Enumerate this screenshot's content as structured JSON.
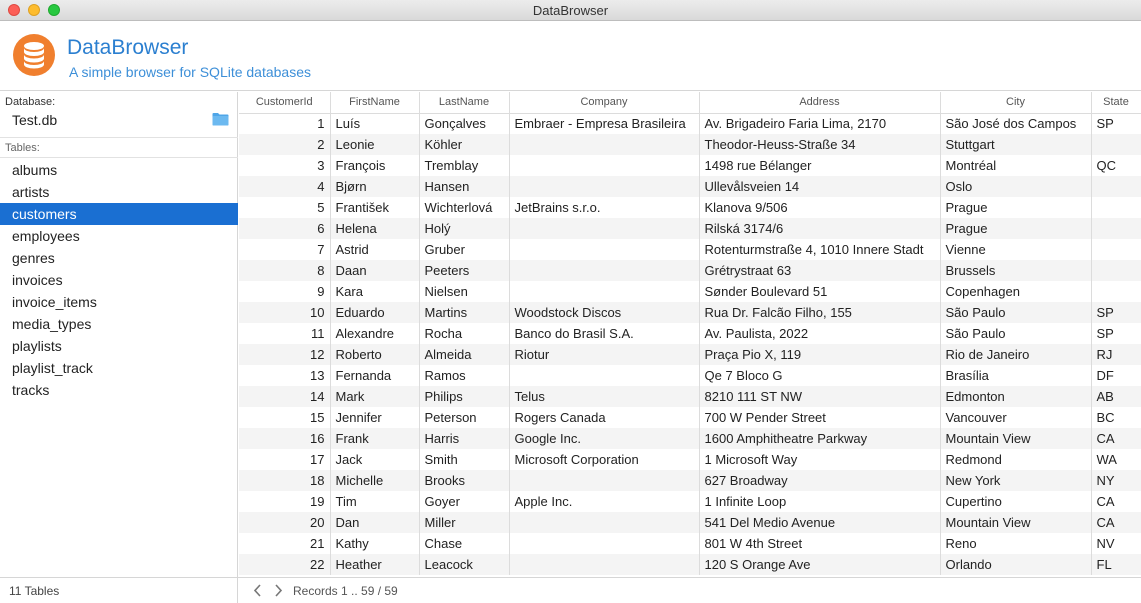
{
  "window": {
    "title": "DataBrowser"
  },
  "header": {
    "app_name": "DataBrowser",
    "tagline": "A simple browser for SQLite databases",
    "logo_icon": "database-icon",
    "accent_color": "#2b7fd0",
    "logo_color": "#f07f2e"
  },
  "sidebar": {
    "database_label": "Database:",
    "database_name": "Test.db",
    "folder_icon": "folder-icon",
    "tables_label": "Tables:",
    "selected": "customers",
    "selection_color": "#1a6fd2",
    "tables": [
      "albums",
      "artists",
      "customers",
      "employees",
      "genres",
      "invoices",
      "invoice_items",
      "media_types",
      "playlists",
      "playlist_track",
      "tracks"
    ]
  },
  "grid": {
    "columns": [
      "CustomerId",
      "FirstName",
      "LastName",
      "Company",
      "Address",
      "City",
      "State"
    ],
    "rows": [
      [
        "1",
        "Luís",
        "Gonçalves",
        "Embraer - Empresa Brasileira",
        "Av. Brigadeiro Faria Lima, 2170",
        "São José dos Campos",
        "SP"
      ],
      [
        "2",
        "Leonie",
        "Köhler",
        "",
        "Theodor-Heuss-Straße 34",
        "Stuttgart",
        ""
      ],
      [
        "3",
        "François",
        "Tremblay",
        "",
        "1498 rue Bélanger",
        "Montréal",
        "QC"
      ],
      [
        "4",
        "Bjørn",
        "Hansen",
        "",
        "Ullevålsveien 14",
        "Oslo",
        ""
      ],
      [
        "5",
        "František",
        "Wichterlová",
        "JetBrains s.r.o.",
        "Klanova 9/506",
        "Prague",
        ""
      ],
      [
        "6",
        "Helena",
        "Holý",
        "",
        "Rilská 3174/6",
        "Prague",
        ""
      ],
      [
        "7",
        "Astrid",
        "Gruber",
        "",
        "Rotenturmstraße 4, 1010 Innere Stadt",
        "Vienne",
        ""
      ],
      [
        "8",
        "Daan",
        "Peeters",
        "",
        "Grétrystraat 63",
        "Brussels",
        ""
      ],
      [
        "9",
        "Kara",
        "Nielsen",
        "",
        "Sønder Boulevard 51",
        "Copenhagen",
        ""
      ],
      [
        "10",
        "Eduardo",
        "Martins",
        "Woodstock Discos",
        "Rua Dr. Falcão Filho, 155",
        "São Paulo",
        "SP"
      ],
      [
        "11",
        "Alexandre",
        "Rocha",
        "Banco do Brasil S.A.",
        "Av. Paulista, 2022",
        "São Paulo",
        "SP"
      ],
      [
        "12",
        "Roberto",
        "Almeida",
        "Riotur",
        "Praça Pio X, 119",
        "Rio de Janeiro",
        "RJ"
      ],
      [
        "13",
        "Fernanda",
        "Ramos",
        "",
        "Qe 7 Bloco G",
        "Brasília",
        "DF"
      ],
      [
        "14",
        "Mark",
        "Philips",
        "Telus",
        "8210 111 ST NW",
        "Edmonton",
        "AB"
      ],
      [
        "15",
        "Jennifer",
        "Peterson",
        "Rogers Canada",
        "700 W Pender Street",
        "Vancouver",
        "BC"
      ],
      [
        "16",
        "Frank",
        "Harris",
        "Google Inc.",
        "1600 Amphitheatre Parkway",
        "Mountain View",
        "CA"
      ],
      [
        "17",
        "Jack",
        "Smith",
        "Microsoft Corporation",
        "1 Microsoft Way",
        "Redmond",
        "WA"
      ],
      [
        "18",
        "Michelle",
        "Brooks",
        "",
        "627 Broadway",
        "New York",
        "NY"
      ],
      [
        "19",
        "Tim",
        "Goyer",
        "Apple Inc.",
        "1 Infinite Loop",
        "Cupertino",
        "CA"
      ],
      [
        "20",
        "Dan",
        "Miller",
        "",
        "541 Del Medio Avenue",
        "Mountain View",
        "CA"
      ],
      [
        "21",
        "Kathy",
        "Chase",
        "",
        "801 W 4th Street",
        "Reno",
        "NV"
      ],
      [
        "22",
        "Heather",
        "Leacock",
        "",
        "120 S Orange Ave",
        "Orlando",
        "FL"
      ]
    ]
  },
  "status": {
    "tables_count": "11 Tables",
    "prev_icon": "chevron-left-icon",
    "next_icon": "chevron-right-icon",
    "records": "Records 1 .. 59 / 59"
  }
}
